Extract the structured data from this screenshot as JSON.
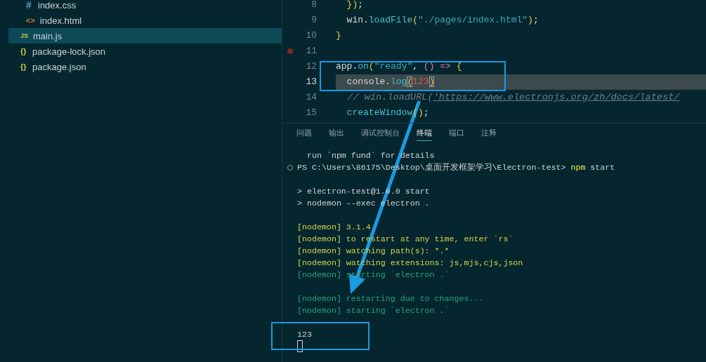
{
  "sidebar": {
    "items": [
      {
        "children": [
          {
            "label": "index.css",
            "icon": "#",
            "kind": "css",
            "selected": false
          },
          {
            "label": "index.html",
            "icon": "<>",
            "kind": "html",
            "selected": false
          }
        ]
      },
      {
        "label": "main.js",
        "icon": "JS",
        "kind": "js",
        "selected": true
      },
      {
        "label": "package-lock.json",
        "icon": "{}",
        "kind": "json",
        "selected": false
      },
      {
        "label": "package.json",
        "icon": "{}",
        "kind": "json",
        "selected": false
      }
    ]
  },
  "editor": {
    "lines": [
      {
        "number": "8",
        "breakpoint": false,
        "current": false,
        "tokens": [
          {
            "text": "  })",
            "kind": "bracket"
          },
          {
            "text": ";",
            "kind": "plain"
          }
        ]
      },
      {
        "number": "9",
        "breakpoint": false,
        "current": false,
        "tokens": [
          {
            "text": "  win.",
            "kind": "plain"
          },
          {
            "text": "loadFile",
            "kind": "fn"
          },
          {
            "text": "(",
            "kind": "bracket"
          },
          {
            "text": "\"./pages/index.html\"",
            "kind": "string"
          },
          {
            "text": ")",
            "kind": "bracket"
          },
          {
            "text": ";",
            "kind": "plain"
          }
        ]
      },
      {
        "number": "10",
        "breakpoint": false,
        "current": false,
        "tokens": [
          {
            "text": "}",
            "kind": "bracket"
          }
        ]
      },
      {
        "number": "11",
        "breakpoint": true,
        "current": false
      },
      {
        "number": "12",
        "breakpoint": false,
        "current": false,
        "tokens": [
          {
            "text": "app.",
            "kind": "plain"
          },
          {
            "text": "on",
            "kind": "fn"
          },
          {
            "text": "(",
            "kind": "bracket"
          },
          {
            "text": "\"ready\"",
            "kind": "string"
          },
          {
            "text": ", ",
            "kind": "plain"
          },
          {
            "text": "()",
            "kind": "bracket2"
          },
          {
            "text": " => ",
            "kind": "op"
          },
          {
            "text": "{",
            "kind": "bracket"
          }
        ]
      },
      {
        "number": "13",
        "breakpoint": false,
        "current": true,
        "tokens": [
          {
            "text": "  console.",
            "kind": "plain"
          },
          {
            "text": "log",
            "kind": "fn"
          },
          {
            "text": "(",
            "kind": "match"
          },
          {
            "text": "123",
            "kind": "number"
          },
          {
            "text": ")",
            "kind": "match"
          }
        ]
      },
      {
        "number": "14",
        "breakpoint": false,
        "current": false,
        "tokens": [
          {
            "text": "  // win.loadURL(",
            "kind": "comment"
          },
          {
            "text": "'https://www.electronjs.org/zh/docs/latest/",
            "kind": "link"
          }
        ]
      },
      {
        "number": "15",
        "breakpoint": false,
        "current": false,
        "tokens": [
          {
            "text": "  createWindow",
            "kind": "fn"
          },
          {
            "text": "()",
            "kind": "bracket"
          },
          {
            "text": ";",
            "kind": "plain"
          }
        ]
      }
    ]
  },
  "panel": {
    "tabs": [
      {
        "label": "问题",
        "selected": false
      },
      {
        "label": "输出",
        "selected": false
      },
      {
        "label": "调试控制台",
        "selected": false
      },
      {
        "label": "终端",
        "selected": true
      },
      {
        "label": "端口",
        "selected": false
      },
      {
        "label": "注释",
        "selected": false
      }
    ],
    "terminal": {
      "blocks": [
        [
          {
            "kind": "output",
            "segments": [
              {
                "text": "  run `npm fund` for details",
                "kind": "plain"
              }
            ]
          },
          {
            "kind": "prompt",
            "segments": [
              {
                "text": "PS C:\\Users\\86175\\Desktop\\桌面开发框架学习\\Electron-test> ",
                "kind": "plain"
              },
              {
                "text": "npm",
                "kind": "command"
              },
              {
                "text": " start",
                "kind": "plain"
              }
            ]
          }
        ],
        [
          {
            "kind": "output",
            "segments": [
              {
                "text": "> electron-test@1.0.0 start",
                "kind": "plain"
              }
            ]
          },
          {
            "kind": "output",
            "segments": [
              {
                "text": "> nodemon --exec electron .",
                "kind": "plain"
              }
            ]
          }
        ],
        [
          {
            "kind": "output",
            "segments": [
              {
                "text": "[nodemon] 3.1.4",
                "kind": "info"
              }
            ]
          },
          {
            "kind": "output",
            "segments": [
              {
                "text": "[nodemon] to restart at any time, enter `rs`",
                "kind": "info"
              }
            ]
          },
          {
            "kind": "output",
            "segments": [
              {
                "text": "[nodemon] watching path(s): *.*",
                "kind": "info"
              }
            ]
          },
          {
            "kind": "output",
            "segments": [
              {
                "text": "[nodemon] watching extensions: js,mjs,cjs,json",
                "kind": "info"
              }
            ]
          },
          {
            "kind": "output",
            "segments": [
              {
                "text": "[nodemon] starting `electron .`",
                "kind": "status"
              }
            ]
          }
        ],
        [
          {
            "kind": "output",
            "segments": [
              {
                "text": "[nodemon] restarting due to changes...",
                "kind": "status"
              }
            ]
          },
          {
            "kind": "output",
            "segments": [
              {
                "text": "[nodemon] starting `electron .`",
                "kind": "status"
              }
            ]
          }
        ],
        [
          {
            "kind": "output",
            "segments": [
              {
                "text": "123",
                "kind": "plain"
              }
            ]
          }
        ]
      ],
      "cursor": true
    }
  }
}
